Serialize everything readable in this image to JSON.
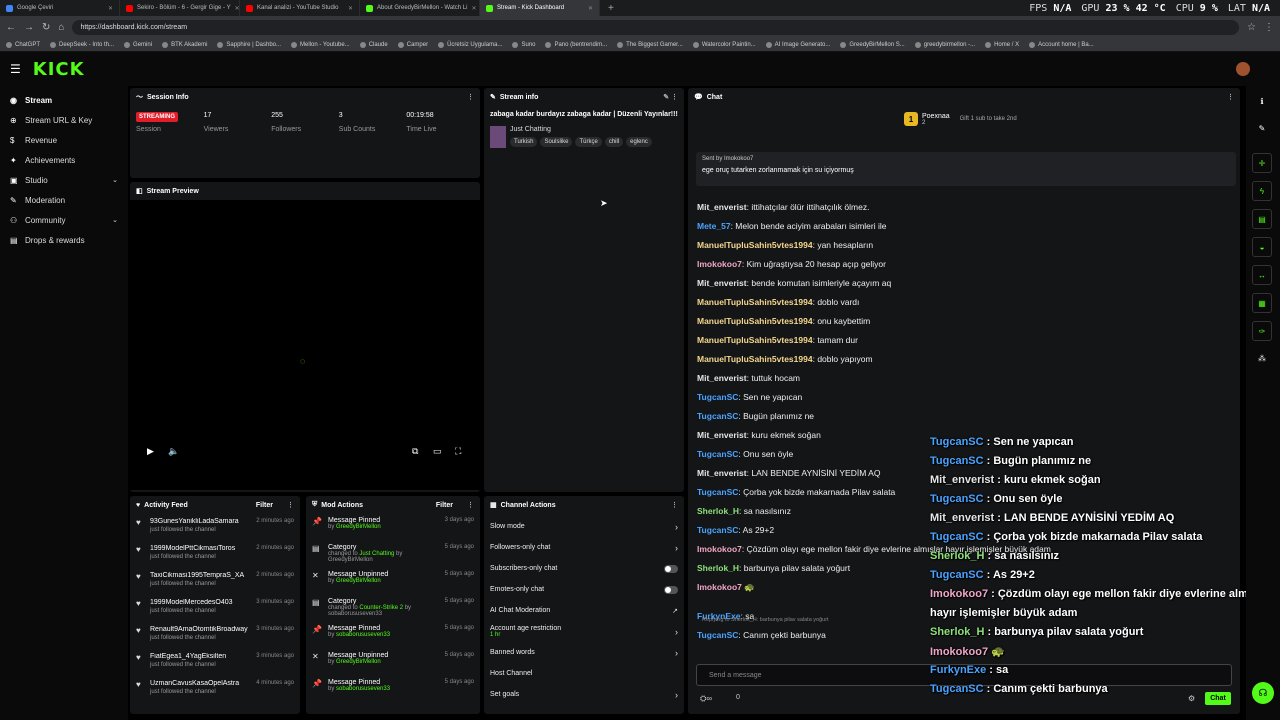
{
  "browser": {
    "tabs": [
      {
        "title": "Google Çeviri",
        "color": "#4285f4"
      },
      {
        "title": "Sekiro - Bölüm - 6 - Gergir Gige - Y",
        "color": "#ff0000"
      },
      {
        "title": "Kanal analizi - YouTube Studio",
        "color": "#ff0000"
      },
      {
        "title": "About GreedyBirMellon - Watch Li",
        "color": "#53fc18"
      },
      {
        "title": "Stream - Kick Dashboard",
        "color": "#53fc18"
      }
    ],
    "url": "https://dashboard.kick.com/stream",
    "bookmarks": [
      "ChatGPT",
      "DeepSeek - Into th...",
      "Gemini",
      "BTK Akademi",
      "Sapphire | Dashbo...",
      "Mellon - Youtube...",
      "Claude",
      "Camper",
      "Ücretsiz Uygulama...",
      "Suno",
      "Pano (bentrendim...",
      "The Biggest Gamer...",
      "Watercolor Paintin...",
      "AI Image Generato...",
      "GreedyBirMellon S...",
      "greedybirmellon -...",
      "Home / X",
      "Account home | Ba..."
    ]
  },
  "hud": {
    "fps_label": "FPS",
    "fps": "N/A",
    "gpu_label": "GPU",
    "gpu": "23 % 42 °C",
    "cpu_label": "CPU",
    "cpu": "9 %",
    "lat_label": "LAT",
    "lat": "N/A"
  },
  "brand": "KICK",
  "sidebar": [
    {
      "label": "Stream",
      "icon": "◉"
    },
    {
      "label": "Stream URL & Key",
      "icon": "⊕"
    },
    {
      "label": "Revenue",
      "icon": "$"
    },
    {
      "label": "Achievements",
      "icon": "✦"
    },
    {
      "label": "Studio",
      "icon": "▣",
      "chev": "⌄"
    },
    {
      "label": "Moderation",
      "icon": "✎"
    },
    {
      "label": "Community",
      "icon": "⚇",
      "chev": "⌄"
    },
    {
      "label": "Drops & rewards",
      "icon": "▤"
    }
  ],
  "session": {
    "title": "Session Info",
    "badge": "STREAMING",
    "badge_label": "Session",
    "viewers": "17",
    "viewers_label": "Viewers",
    "followers": "255",
    "followers_label": "Followers",
    "subs": "3",
    "subs_label": "Sub Counts",
    "time": "00:19:58",
    "time_label": "Time Live"
  },
  "stream_info": {
    "title": "Stream info",
    "stream_title": "zabaga kadar burdayız zabaga kadar | Düzenli Yayınlar!!!",
    "category": "Just Chatting",
    "tags": [
      "Turkish",
      "Soulslike",
      "Türkçe",
      "chill",
      "eglenc"
    ]
  },
  "preview": {
    "title": "Stream Preview"
  },
  "activity": {
    "title": "Activity Feed",
    "filter": "Filter",
    "items": [
      {
        "name": "93GunesYanikliLadaSamara",
        "sub": "just followed the channel",
        "time": "2 minutes ago"
      },
      {
        "name": "1999ModelPttCikmasiToros",
        "sub": "just followed the channel",
        "time": "2 minutes ago"
      },
      {
        "name": "TaxiCikmasi1995TempraS_XA",
        "sub": "just followed the channel",
        "time": "2 minutes ago"
      },
      {
        "name": "1999ModelMercedesO403",
        "sub": "just followed the channel",
        "time": "3 minutes ago"
      },
      {
        "name": "Renault9AmaOtomtikBroadway",
        "sub": "just followed the channel",
        "time": "3 minutes ago"
      },
      {
        "name": "FiatEgea1_4YagEksilten",
        "sub": "just followed the channel",
        "time": "3 minutes ago"
      },
      {
        "name": "UzmanCavusKasaOpelAstra",
        "sub": "just followed the channel",
        "time": "4 minutes ago"
      }
    ]
  },
  "mod": {
    "title": "Mod Actions",
    "filter": "Filter",
    "items": [
      {
        "icon": "📌",
        "name": "Message Pinned",
        "by": "by ",
        "who": "GreedyBirMellon",
        "extra": "",
        "time": "3 days ago"
      },
      {
        "icon": "▤",
        "name": "Category",
        "by": "changed to ",
        "who": "Just Chatting",
        "extra": " by GreedyBirMellon",
        "time": "5 days ago"
      },
      {
        "icon": "✕",
        "name": "Message Unpinned",
        "by": "by ",
        "who": "GreedyBirMellon",
        "extra": "",
        "time": "5 days ago"
      },
      {
        "icon": "▤",
        "name": "Category",
        "by": "changed to ",
        "who": "Counter-Strike 2",
        "extra": " by sobaborususeven33",
        "time": "5 days ago"
      },
      {
        "icon": "📌",
        "name": "Message Pinned",
        "by": "by ",
        "who": "sobaborususeven33",
        "extra": "",
        "time": "5 days ago"
      },
      {
        "icon": "✕",
        "name": "Message Unpinned",
        "by": "by ",
        "who": "GreedyBirMellon",
        "extra": "",
        "time": "5 days ago"
      },
      {
        "icon": "📌",
        "name": "Message Pinned",
        "by": "by ",
        "who": "sobaborususeven33",
        "extra": "",
        "time": "5 days ago"
      }
    ]
  },
  "channel_actions": {
    "title": "Channel Actions",
    "items": [
      {
        "label": "Slow mode",
        "type": "arrow"
      },
      {
        "label": "Followers-only chat",
        "type": "arrow"
      },
      {
        "label": "Subscribers-only chat",
        "type": "toggle"
      },
      {
        "label": "Emotes-only chat",
        "type": "toggle"
      },
      {
        "label": "AI Chat Moderation",
        "type": "ext"
      },
      {
        "label": "Account age restriction",
        "type": "arrow",
        "sub": "1 hr"
      },
      {
        "label": "Banned words",
        "type": "arrow"
      },
      {
        "label": "Host Channel",
        "type": "none"
      },
      {
        "label": "Set goals",
        "type": "arrow"
      }
    ]
  },
  "chat": {
    "title": "Chat",
    "top_gifter": "Poexnaa",
    "top_gifter_count": "2",
    "gift_prompt": "Gift 1 sub to take 2nd",
    "pinned_by": "Sent by Imokokoo7",
    "pinned_text": "ege oruç tutarken zorlanmamak için su içiyormuş",
    "messages": [
      {
        "user": "Mit_enverist",
        "text": "ittihatçılar ölür ittihatçılık ölmez.",
        "color": "#e6e6e6"
      },
      {
        "user": "Mete_57",
        "text": "Melon bende aciyim arabaları isimleri ile",
        "color": "#4aa3ff"
      },
      {
        "user": "ManuelTupluSahin5vtes1994",
        "text": "yan hesapların",
        "color": "#f5d78e"
      },
      {
        "user": "Imokokoo7",
        "text": "Kim uğraştıysa 20 hesap açıp geliyor",
        "color": "#f0a6c8"
      },
      {
        "user": "Mit_enverist",
        "text": "bende komutan isimleriyle açayım aq",
        "color": "#e6e6e6"
      },
      {
        "user": "ManuelTupluSahin5vtes1994",
        "text": "doblo vardı",
        "color": "#f5d78e"
      },
      {
        "user": "ManuelTupluSahin5vtes1994",
        "text": "onu kaybettim",
        "color": "#f5d78e"
      },
      {
        "user": "ManuelTupluSahin5vtes1994",
        "text": "tamam dur",
        "color": "#f5d78e"
      },
      {
        "user": "ManuelTupluSahin5vtes1994",
        "text": "doblo yapıyom",
        "color": "#f5d78e"
      },
      {
        "user": "Mit_enverist",
        "text": "tuttuk hocam",
        "color": "#e6e6e6"
      },
      {
        "user": "TugcanSC",
        "text": "Sen ne yapıcan",
        "color": "#4aa3ff"
      },
      {
        "user": "TugcanSC",
        "text": "Bugün planımız ne",
        "color": "#4aa3ff"
      },
      {
        "user": "Mit_enverist",
        "text": "kuru ekmek soğan",
        "color": "#e6e6e6"
      },
      {
        "user": "TugcanSC",
        "text": "Onu sen öyle",
        "color": "#4aa3ff"
      },
      {
        "user": "Mit_enverist",
        "text": "LAN BENDE AYNİSİNİ YEDİM AQ",
        "color": "#e6e6e6"
      },
      {
        "user": "TugcanSC",
        "text": "Çorba yok bizde makarnada Pilav salata",
        "color": "#4aa3ff"
      },
      {
        "user": "Sherlok_H",
        "text": "sa nasılsınız",
        "color": "#8ee07a"
      },
      {
        "user": "TugcanSC",
        "text": "As 29+2",
        "color": "#4aa3ff"
      },
      {
        "user": "Imokokoo7",
        "text": "Çözdüm olayı ege mellon fakir diye evlerine almışlar hayır işlemişler büyük adam",
        "color": "#f0a6c8"
      },
      {
        "user": "Sherlok_H",
        "text": "barbunya pilav salata yoğurt",
        "color": "#8ee07a"
      },
      {
        "user": "Imokokoo7",
        "text": "",
        "color": "#f0a6c8"
      },
      {
        "user": "FurkynExe",
        "text": "sa",
        "color": "#4aa3ff"
      },
      {
        "user": "TugcanSC",
        "text": "Canım çekti barbunya",
        "color": "#4aa3ff"
      }
    ],
    "reply_hint": "Replying to Sherlok_H: barbunya pilav salata yoğurt",
    "placeholder": "Send a message",
    "send_label": "Chat",
    "viewer_count": "0"
  },
  "overlay": [
    {
      "user": "TugcanSC",
      "text": "Sen ne yapıcan",
      "color": "#4aa3ff"
    },
    {
      "user": "TugcanSC",
      "text": "Bugün planımız ne",
      "color": "#4aa3ff"
    },
    {
      "user": "Mit_enverist",
      "text": "kuru ekmek soğan",
      "color": "#e6e6e6"
    },
    {
      "user": "TugcanSC",
      "text": "Onu sen öyle",
      "color": "#4aa3ff"
    },
    {
      "user": "Mit_enverist",
      "text": "LAN BENDE AYNİSİNİ YEDİM AQ",
      "color": "#e6e6e6"
    },
    {
      "user": "TugcanSC",
      "text": "Çorba yok bizde makarnada Pilav salata",
      "color": "#4aa3ff"
    },
    {
      "user": "Sherlok_H",
      "text": "sa nasılsınız",
      "color": "#8ee07a"
    },
    {
      "user": "TugcanSC",
      "text": "As 29+2",
      "color": "#4aa3ff"
    },
    {
      "user": "Imokokoo7",
      "text": "Çözdüm olayı ege mellon fakir diye evlerine almışlar",
      "color": "#f0a6c8"
    },
    {
      "user": "",
      "text": "hayır işlemişler büyük adam",
      "color": "#f0a6c8"
    },
    {
      "user": "Sherlok_H",
      "text": "barbunya pilav salata yoğurt",
      "color": "#8ee07a"
    },
    {
      "user": "Imokokoo7",
      "text": "",
      "color": "#f0a6c8"
    },
    {
      "user": "FurkynExe",
      "text": "sa",
      "color": "#4aa3ff"
    },
    {
      "user": "TugcanSC",
      "text": "Canım çekti barbunya",
      "color": "#4aa3ff"
    }
  ],
  "colors": {
    "accent": "#53fc18",
    "live": "#e21d2a",
    "panel": "#141517"
  }
}
